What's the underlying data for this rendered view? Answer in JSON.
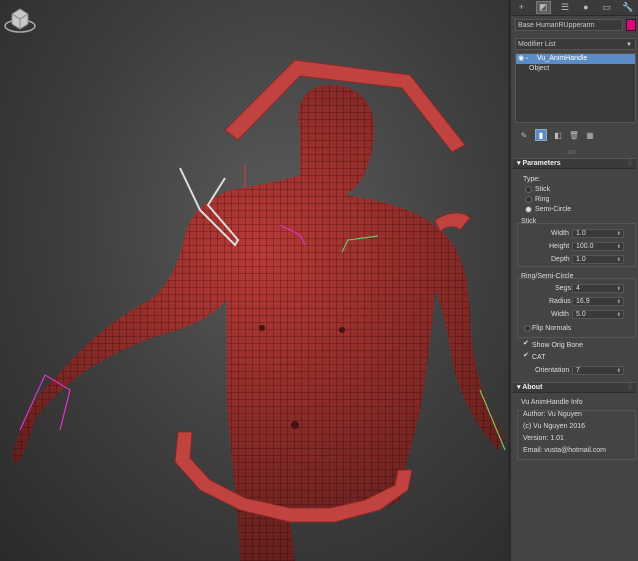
{
  "command_panel": {
    "tabs": [
      {
        "name": "create",
        "glyph": "+"
      },
      {
        "name": "modify",
        "glyph": "◩"
      },
      {
        "name": "hierarchy",
        "glyph": "☰"
      },
      {
        "name": "motion",
        "glyph": "●"
      },
      {
        "name": "display",
        "glyph": "▭"
      },
      {
        "name": "utilities",
        "glyph": "🔧"
      }
    ],
    "object_name": "Base HumanRUpperarm",
    "object_color": "#e6007a",
    "modifier_list_label": "Modifier List",
    "stack": [
      {
        "label": "Vu_AnimHandle",
        "selected": true
      },
      {
        "label": "Object",
        "selected": false
      }
    ]
  },
  "parameters": {
    "title": "Parameters",
    "type_label": "Type:",
    "types": [
      {
        "label": "Stick",
        "selected": false
      },
      {
        "label": "Ring",
        "selected": false
      },
      {
        "label": "Semi-Circle",
        "selected": true
      }
    ],
    "stick_group": "Stick",
    "stick_fields": [
      {
        "label": "Width",
        "value": "1.0"
      },
      {
        "label": "Height",
        "value": "100.0"
      },
      {
        "label": "Depth",
        "value": "1.0"
      }
    ],
    "ring_group": "Ring/Semi-Circle",
    "ring_fields": [
      {
        "label": "Segs",
        "value": "4"
      },
      {
        "label": "Radius",
        "value": "16.9"
      },
      {
        "label": "Width",
        "value": "5.0"
      }
    ],
    "flip_normals": {
      "label": "Flip Normals",
      "checked": false
    },
    "show_orig_bone": {
      "label": "Show Orig Bone",
      "checked": true
    },
    "cat": {
      "label": "CAT",
      "checked": true
    },
    "orientation": {
      "label": "Orientation",
      "value": "7"
    }
  },
  "about": {
    "title": "About",
    "group_label": "Vu AnimHandle Info",
    "lines": [
      "Author: Vu Nguyen",
      "(c) Vu Nguyen 2016",
      "Version: 1.01",
      "Email: vusta@hotmail.com"
    ]
  }
}
